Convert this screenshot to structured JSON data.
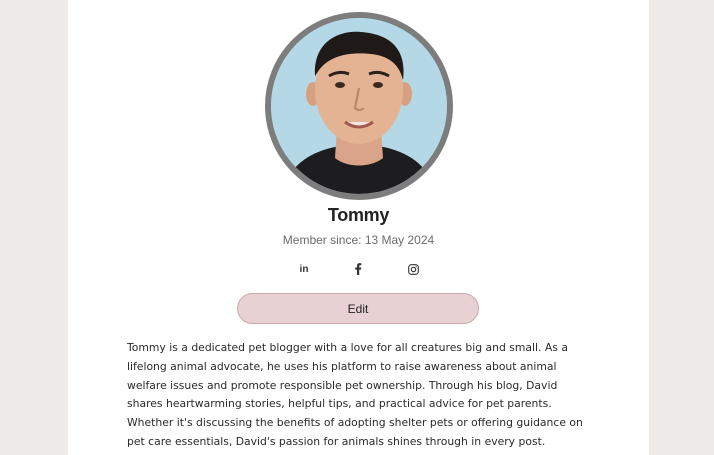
{
  "profile": {
    "name": "Tommy",
    "member_since": "Member since: 13 May 2024",
    "edit_label": "Edit",
    "bio": "Tommy is a dedicated pet blogger with a love for all creatures big and small. As a lifelong animal advocate, he uses his platform to raise awareness about animal welfare issues and promote responsible pet ownership. Through his blog, David shares heartwarming stories, helpful tips, and practical advice for pet parents. Whether it's discussing the benefits of adopting shelter pets or offering guidance on pet care essentials, David's passion for animals shines through in every post."
  },
  "social": [
    {
      "icon": "linkedin-icon"
    },
    {
      "icon": "facebook-icon"
    },
    {
      "icon": "instagram-icon"
    }
  ],
  "colors": {
    "page_background": "#efebe9",
    "card_background": "#ffffff",
    "avatar_border": "#7d7d7d",
    "avatar_background": "#b4d8e6",
    "edit_button_background": "#e8d1d3"
  }
}
